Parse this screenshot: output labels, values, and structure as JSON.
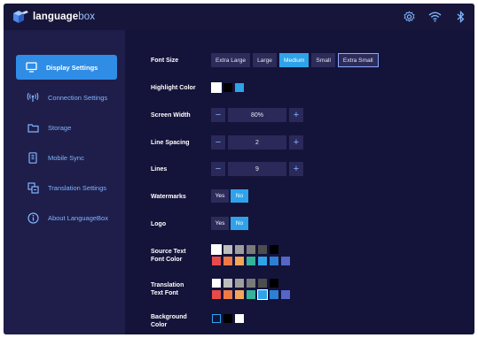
{
  "app": {
    "logo_main": "language",
    "logo_box": "box"
  },
  "topbar": {
    "icons": [
      "settings-icon",
      "wifi-icon",
      "bluetooth-icon"
    ]
  },
  "sidebar": {
    "items": [
      {
        "label": "Display Settings",
        "icon": "monitor-icon",
        "active": true
      },
      {
        "label": "Connection Settings",
        "icon": "broadcast-icon",
        "active": false
      },
      {
        "label": "Storage",
        "icon": "folder-icon",
        "active": false
      },
      {
        "label": "Mobile Sync",
        "icon": "phone-icon",
        "active": false
      },
      {
        "label": "Translation Settings",
        "icon": "translate-icon",
        "active": false
      },
      {
        "label": "About LanguageBox",
        "icon": "info-icon",
        "active": false
      }
    ]
  },
  "settings": {
    "font_size": {
      "label": "Font Size",
      "options": [
        "Extra Large",
        "Large",
        "Medium",
        "Small",
        "Extra Small"
      ],
      "selected": "Medium"
    },
    "highlight_color": {
      "label": "Highlight Color",
      "colors": [
        "#ffffff",
        "#000000",
        "#2ea3ea"
      ],
      "selected": "#ffffff"
    },
    "screen_width": {
      "label": "Screen Width",
      "value": "80%",
      "minus": "−",
      "plus": "+"
    },
    "line_spacing": {
      "label": "Line Spacing",
      "value": "2",
      "minus": "−",
      "plus": "+"
    },
    "lines": {
      "label": "Lines",
      "value": "9",
      "minus": "−",
      "plus": "+"
    },
    "watermarks": {
      "label": "Watermarks",
      "yes": "Yes",
      "no": "No",
      "selected": "No"
    },
    "logo": {
      "label": "Logo",
      "yes": "Yes",
      "no": "No",
      "selected": "No"
    },
    "source_text_font_color": {
      "label_line1": "Source Text",
      "label_line2": "Font Color",
      "row1": [
        "#ffffff",
        "#bdbdbd",
        "#9e9e9e",
        "#7a7a7a",
        "#4d4d4d",
        "#000000"
      ],
      "row2": [
        "#e84a4a",
        "#ee7a45",
        "#f3a55a",
        "#35b29a",
        "#2ea3ea",
        "#2d7fd4",
        "#5566c8"
      ],
      "selected": "#ffffff"
    },
    "translation_text_font": {
      "label_line1": "Translation",
      "label_line2": "Text Font",
      "row1": [
        "#ffffff",
        "#bdbdbd",
        "#9e9e9e",
        "#7a7a7a",
        "#4d4d4d",
        "#000000"
      ],
      "row2": [
        "#e84a4a",
        "#ee7a45",
        "#f3a55a",
        "#35b29a",
        "#2ea3ea",
        "#2d7fd4",
        "#5566c8"
      ],
      "selected": "#2ea3ea"
    },
    "background_color": {
      "label_line1": "Background",
      "label_line2": "Color",
      "colors": [
        "#14133a",
        "#000000",
        "#ffffff"
      ],
      "selected": "#14133a"
    }
  }
}
